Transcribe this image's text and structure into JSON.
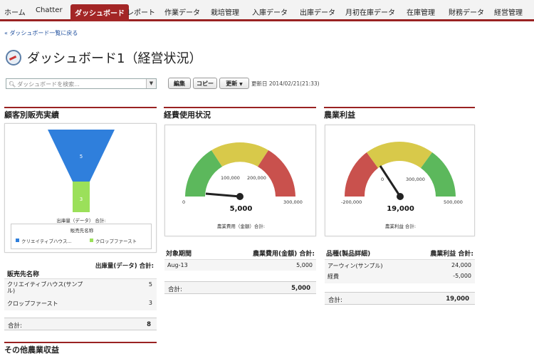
{
  "nav": {
    "tabs": [
      "ホーム",
      "Chatter",
      "ダッシュボード",
      "レポート",
      "作業データ",
      "栽培管理",
      "入庫データ",
      "出庫データ",
      "月初在庫データ",
      "在庫管理",
      "財務データ",
      "経営管理"
    ],
    "active_index": 2
  },
  "backlink": "« ダッシュボード一覧に戻る",
  "page_title": "ダッシュボード1（経営状況）",
  "search": {
    "placeholder": "ダッシュボードを検索..."
  },
  "toolbar": {
    "edit": "編集",
    "copy": "コピー",
    "refresh": "更新",
    "updated": "更新日 2014/02/21(21:33)"
  },
  "sections": {
    "customer_sales": "顧客別販売実績",
    "expense": "経費使用状況",
    "profit": "農業利益",
    "other": "その他農業収益"
  },
  "funnel": {
    "values": [
      5,
      3
    ],
    "caption": "出庫量（データ） 合計:",
    "legend_title": "販売先名称",
    "legend": [
      "クリエイティブハウス...",
      "クロップファースト"
    ],
    "colors": [
      "#2f7fdc",
      "#9be05a"
    ],
    "table": {
      "col1": "販売先名称",
      "col2": "出庫量(データ) 合計:",
      "rows": [
        {
          "name": "クリエイティブハウス(サンプル)",
          "value": "5"
        },
        {
          "name": "クロップファースト",
          "value": "3"
        }
      ],
      "total_label": "合計:",
      "total": "8"
    }
  },
  "expense_gauge": {
    "value_text": "5,000",
    "value": 5000,
    "min": 0,
    "max": 300000,
    "ticks": [
      "0",
      "100,000",
      "200,000",
      "300,000"
    ],
    "caption": "農業費用（金額）合計:",
    "table": {
      "col1": "対象期間",
      "col2": "農業費用(金額) 合計:",
      "rows": [
        {
          "name": "Aug-13",
          "value": "5,000"
        }
      ],
      "total_label": "合計:",
      "total": "5,000"
    }
  },
  "profit_gauge": {
    "value_text": "19,000",
    "value": 19000,
    "min": -200000,
    "max": 500000,
    "ticks": [
      "-200,000",
      "0",
      "300,000",
      "500,000"
    ],
    "caption": "農業利益 合計:",
    "table": {
      "col1": "品種(製品詳細)",
      "col2": "農業利益 合計:",
      "rows": [
        {
          "name": "アーウィン(サンプル)",
          "value": "24,000"
        },
        {
          "name": "経費",
          "value": "-5,000"
        }
      ],
      "total_label": "合計:",
      "total": "19,000"
    }
  },
  "colors": {
    "accent": "#9a2222",
    "gauge_green": "#5cb85c",
    "gauge_yellow": "#d8c94a",
    "gauge_red": "#c9514d"
  }
}
